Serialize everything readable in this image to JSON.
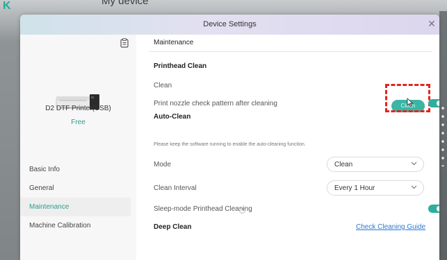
{
  "background": {
    "app_title": "My device",
    "logo": "K"
  },
  "dialog": {
    "title": "Device Settings",
    "close_icon": "close-icon"
  },
  "sidebar": {
    "printer_name": "D2 DTF Printer(USB)",
    "printer_status": "Free",
    "items": [
      {
        "label": "Basic Info",
        "active": false
      },
      {
        "label": "General",
        "active": false
      },
      {
        "label": "Maintenance",
        "active": true
      },
      {
        "label": "Machine Calibration",
        "active": false
      }
    ]
  },
  "main": {
    "section_title": "Maintenance",
    "printhead_clean": {
      "heading": "Printhead Clean",
      "clean_label": "Clean",
      "clean_button": "Clean",
      "nozzle_check_label": "Print nozzle check pattern after cleaning",
      "nozzle_check_on": true
    },
    "auto_clean": {
      "heading": "Auto-Clean",
      "note": "Please keep the software running to enable the auto-cleaning function.",
      "mode_label": "Mode",
      "mode_value": "Clean",
      "interval_label": "Clean Interval",
      "interval_value": "Every 1 Hour",
      "sleep_label": "Sleep-mode Printhead Cleaning",
      "sleep_on": true
    },
    "deep_clean": {
      "heading": "Deep Clean",
      "guide_link": "Check Cleaning Guide"
    }
  },
  "colors": {
    "accent": "#2fae9f",
    "highlight": "#e1241f",
    "link": "#2b78d0"
  }
}
